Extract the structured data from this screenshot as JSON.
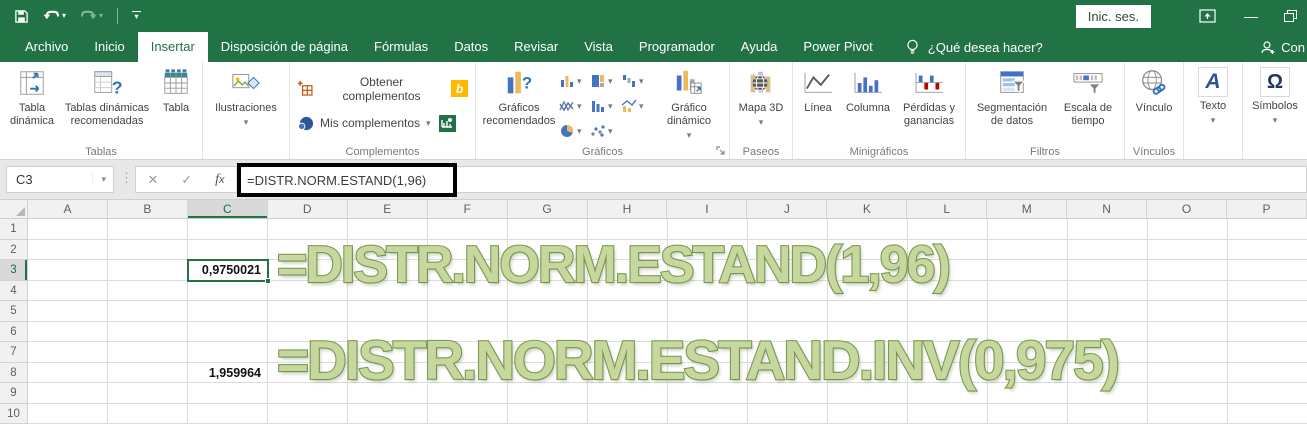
{
  "titlebar": {
    "sign_in": "Inic. ses."
  },
  "tabs": {
    "items": [
      {
        "label": "Archivo"
      },
      {
        "label": "Inicio"
      },
      {
        "label": "Insertar",
        "active": true
      },
      {
        "label": "Disposición de página"
      },
      {
        "label": "Fórmulas"
      },
      {
        "label": "Datos"
      },
      {
        "label": "Revisar"
      },
      {
        "label": "Vista"
      },
      {
        "label": "Programador"
      },
      {
        "label": "Ayuda"
      },
      {
        "label": "Power Pivot"
      }
    ],
    "search_label": "¿Qué desea hacer?",
    "share_label": "Con"
  },
  "ribbon": {
    "tablas": {
      "label": "Tablas",
      "pivot": "Tabla dinámica",
      "recommended": "Tablas dinámicas recomendadas",
      "table": "Tabla"
    },
    "ilustraciones": {
      "button": "Ilustraciones"
    },
    "complementos": {
      "label": "Complementos",
      "get": "Obtener complementos",
      "mine": "Mis complementos"
    },
    "graficos": {
      "label": "Gráficos",
      "recommended": "Gráficos recomendados",
      "pivot_chart": "Gráfico dinámico"
    },
    "paseos": {
      "label": "Paseos",
      "map3d": "Mapa 3D"
    },
    "minigraficos": {
      "label": "Minigráficos",
      "line": "Línea",
      "column": "Columna",
      "winloss": "Pérdidas y ganancias"
    },
    "filtros": {
      "label": "Filtros",
      "slicer": "Segmentación de datos",
      "timeline": "Escala de tiempo"
    },
    "vinculos": {
      "label": "Vínculos",
      "link": "Vínculo"
    },
    "texto": {
      "button": "Texto"
    },
    "simbolos": {
      "button": "Símbolos"
    }
  },
  "formula_bar": {
    "name_box": "C3",
    "formula": "=DISTR.NORM.ESTAND(1,96)"
  },
  "sheet": {
    "columns": [
      "A",
      "B",
      "C",
      "D",
      "E",
      "F",
      "G",
      "H",
      "I",
      "J",
      "K",
      "L",
      "M",
      "N",
      "O",
      "P"
    ],
    "rows": [
      1,
      2,
      3,
      4,
      5,
      6,
      7,
      8,
      9,
      10
    ],
    "selection": {
      "col": "C",
      "row": 3
    },
    "cells": [
      {
        "col": "C",
        "row": 3,
        "value": "0,9750021"
      },
      {
        "col": "C",
        "row": 8,
        "value": "1,959964"
      }
    ],
    "wordart": [
      {
        "text": "=DISTR.NORM.ESTAND(1,96)"
      },
      {
        "text": "=DISTR.NORM.ESTAND.INV(0,975)"
      }
    ]
  },
  "icons": {
    "caret_down": "▾",
    "dots": "⋮",
    "cancel": "✕",
    "enter": "✓",
    "fx_sub": "x",
    "text_glyph": "A",
    "omega": "Ω",
    "minimize": "—"
  },
  "colors": {
    "accent_green": "#217346",
    "wordart_fill": "#c6d89e",
    "wordart_stroke": "#7d9b52",
    "chart_blue": "#4472c4",
    "chart_tan": "#edb95e"
  }
}
